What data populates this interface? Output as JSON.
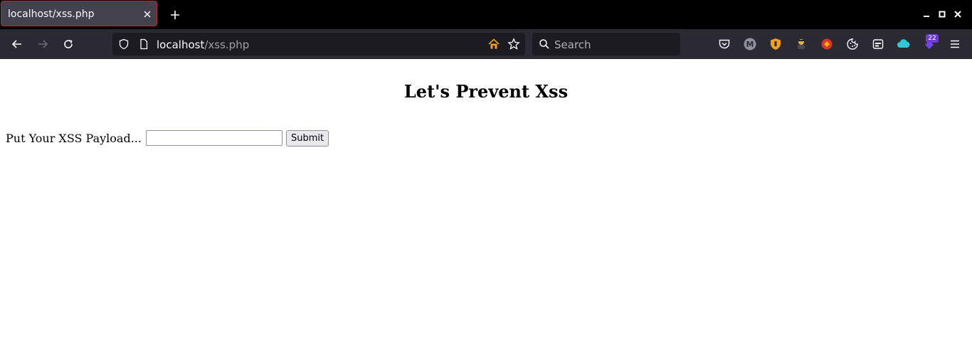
{
  "tabs": [
    {
      "title": "localhost/xss.php",
      "active": true
    }
  ],
  "toolbar": {
    "url_host": "localhost",
    "url_path": "/xss.php",
    "search_placeholder": "Search",
    "extension_badge_count": "22"
  },
  "icons": {
    "tab_close": "close-icon",
    "new_tab": "plus-icon",
    "back": "back-arrow-icon",
    "forward": "forward-arrow-icon",
    "reload": "reload-icon",
    "site_info": "shield-icon",
    "page": "page-icon",
    "home_feature": "home-icon",
    "bookmark": "star-icon",
    "search": "search-icon",
    "pocket": "pocket-icon",
    "account": "m-avatar-icon",
    "menu": "hamburger-icon"
  },
  "colors": {
    "active_tab_border": "#c5262c",
    "badge_background": "#6f3bd6",
    "toolbar_background": "#2b2a33",
    "tabstrip_background": "#000000"
  },
  "page": {
    "heading": "Let's Prevent Xss",
    "form_label": "Put Your XSS Payload...",
    "input_value": "",
    "submit_label": "Submit"
  }
}
